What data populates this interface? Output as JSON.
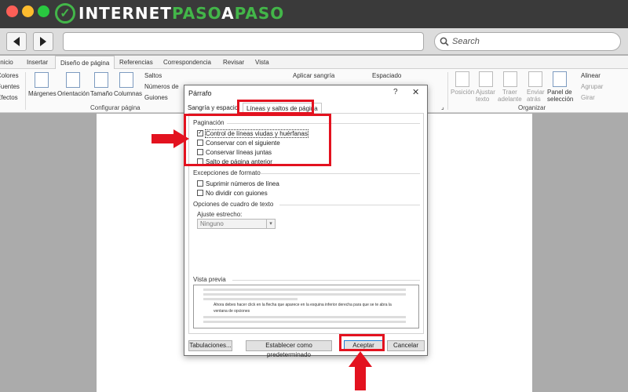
{
  "browser": {
    "logo_text_1": "INTERNET",
    "logo_text_2": "PASO",
    "logo_text_3": "A",
    "logo_text_4": "PASO",
    "search_label": "Search",
    "colors": {
      "titlebar": "#3a3a3a",
      "brand_green": "#43b649",
      "close": "#fd5f57",
      "minimize": "#fdbc2e",
      "maximize": "#29c940"
    }
  },
  "ribbon": {
    "tabs": [
      "Inicio",
      "Insertar",
      "Diseño de página",
      "Referencias",
      "Correspondencia",
      "Revisar",
      "Vista"
    ],
    "active_tab": "Diseño de página",
    "left_items": [
      "Colores",
      "Fuentes",
      "Efectos"
    ],
    "page_setup": {
      "margenes": "Márgenes",
      "orientacion": "Orientación",
      "tamano": "Tamaño",
      "columnas": "Columnas",
      "saltos": "Saltos",
      "numeros": "Números de",
      "guiones": "Guiones",
      "group": "Configurar página"
    },
    "paragraph": {
      "sangria": "Aplicar sangría",
      "espaciado": "Espaciado"
    },
    "arrange": {
      "posicion": "Posición",
      "ajustar_1": "Ajustar",
      "ajustar_2": "texto",
      "traer_1": "Traer",
      "traer_2": "adelante",
      "enviar_1": "Enviar",
      "enviar_2": "atrás",
      "panel_1": "Panel de",
      "panel_2": "selección",
      "alinear": "Alinear",
      "agrupar": "Agrupar",
      "girar": "Girar",
      "group": "Organizar"
    }
  },
  "dialog": {
    "title": "Párrafo",
    "help": "?",
    "close": "✕",
    "tabs": [
      "Sangría y espacio",
      "Líneas y saltos de página"
    ],
    "active_tab": "Líneas y saltos de página",
    "pagination": {
      "heading": "Paginación",
      "options": [
        {
          "label": "Control de líneas viudas y huérfanas",
          "checked": true
        },
        {
          "label": "Conservar con el siguiente",
          "checked": false
        },
        {
          "label": "Conservar líneas juntas",
          "checked": false
        },
        {
          "label": "Salto de página anterior",
          "checked": false
        }
      ]
    },
    "exceptions": {
      "heading": "Excepciones de formato",
      "options": [
        {
          "label": "Suprimir números de línea",
          "checked": false
        },
        {
          "label": "No dividir con guiones",
          "checked": false
        }
      ]
    },
    "textbox": {
      "heading": "Opciones de cuadro de texto",
      "tight_label": "Ajuste estrecho:",
      "tight_value": "Ninguno"
    },
    "preview": {
      "heading": "Vista previa",
      "sample_text": "Ahora debes hacer click en la flecha que aparece en la esquina inferior derecha para que se te abra la ventana de opciones"
    },
    "buttons": {
      "tabs": "Tabulaciones...",
      "default": "Establecer como predeterminado",
      "ok": "Aceptar",
      "cancel": "Cancelar"
    }
  },
  "annotation_color": "#e3121f"
}
